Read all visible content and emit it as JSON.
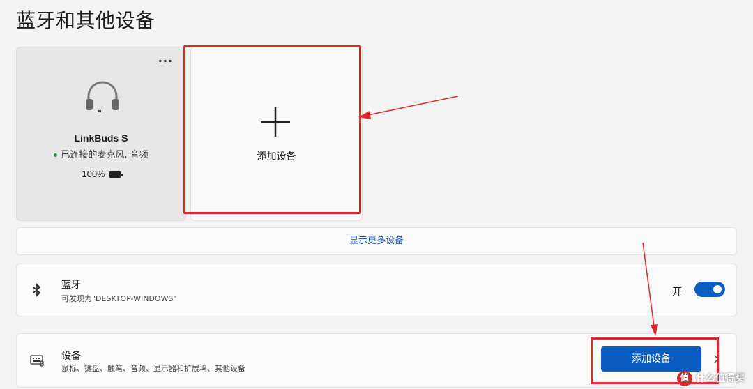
{
  "page": {
    "title": "蓝牙和其他设备"
  },
  "device_card": {
    "more_label": "···",
    "name": "LinkBuds S",
    "status": "已连接的麦克风, 音频",
    "battery": "100%",
    "status_color": "#1f9d3a"
  },
  "add_card": {
    "label": "添加设备"
  },
  "show_more": {
    "label": "显示更多设备"
  },
  "bluetooth": {
    "title": "蓝牙",
    "subtitle": "可发现为\"DESKTOP-WINDOWS\"",
    "toggle_label": "开",
    "toggle_on": true
  },
  "devices": {
    "title": "设备",
    "subtitle": "鼠标、键盘、触笔、音频、显示器和扩展坞、其他设备",
    "add_button": "添加设备"
  },
  "watermark": {
    "badge": "值",
    "text": "什么值得买"
  },
  "colors": {
    "accent": "#0b5cc1",
    "highlight": "#e0262d",
    "link": "#1a57b0"
  }
}
